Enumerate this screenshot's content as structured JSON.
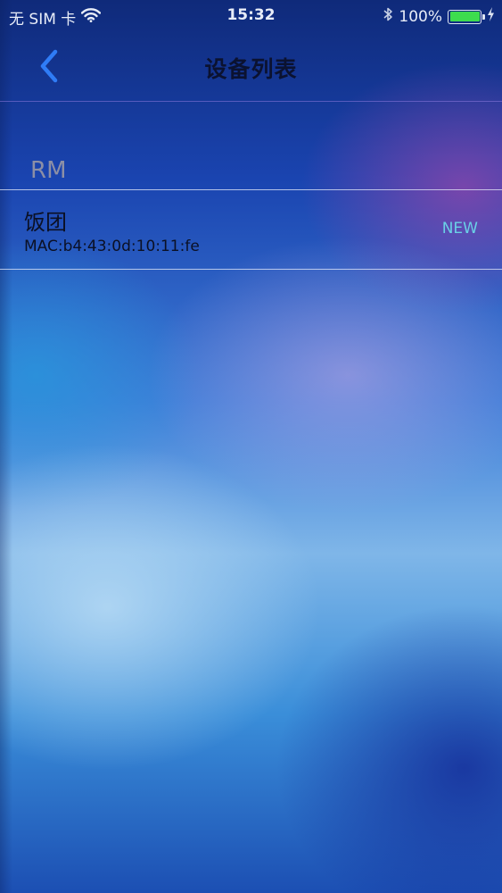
{
  "status_bar": {
    "carrier": "无 SIM 卡",
    "time": "15:32",
    "battery_percent": "100%",
    "battery_level": 1.0,
    "icons": [
      "wifi-icon",
      "bluetooth-icon",
      "battery-icon",
      "charging-icon"
    ]
  },
  "nav": {
    "title": "设备列表",
    "back_icon": "chevron-left-icon"
  },
  "section": {
    "header": "RM"
  },
  "devices": [
    {
      "name": "饭团",
      "mac": "MAC:b4:43:0d:10:11:fe",
      "badge": "NEW"
    }
  ],
  "colors": {
    "accent": "#2f7cf6",
    "badge": "#6ad0e6",
    "battery": "#3ddc4e"
  }
}
